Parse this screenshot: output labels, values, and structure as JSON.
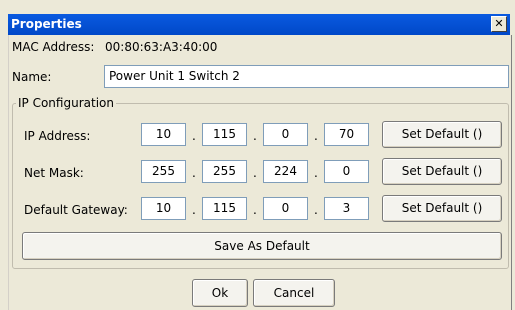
{
  "window": {
    "title": "Properties",
    "close_glyph": "✕"
  },
  "mac": {
    "label": "MAC Address:",
    "value": "00:80:63:A3:40:00"
  },
  "name": {
    "label": "Name:",
    "value": "Power Unit 1 Switch 2"
  },
  "ip_config": {
    "legend": "IP Configuration",
    "rows": [
      {
        "label": "IP Address:",
        "octets": [
          "10",
          "115",
          "0",
          "70"
        ],
        "button": "Set Default ()"
      },
      {
        "label": "Net Mask:",
        "octets": [
          "255",
          "255",
          "224",
          "0"
        ],
        "button": "Set Default ()"
      },
      {
        "label": "Default Gateway:",
        "octets": [
          "10",
          "115",
          "0",
          "3"
        ],
        "button": "Set Default ()"
      }
    ],
    "dot": ".",
    "save_default": "Save As Default"
  },
  "footer": {
    "ok": "Ok",
    "cancel": "Cancel"
  }
}
